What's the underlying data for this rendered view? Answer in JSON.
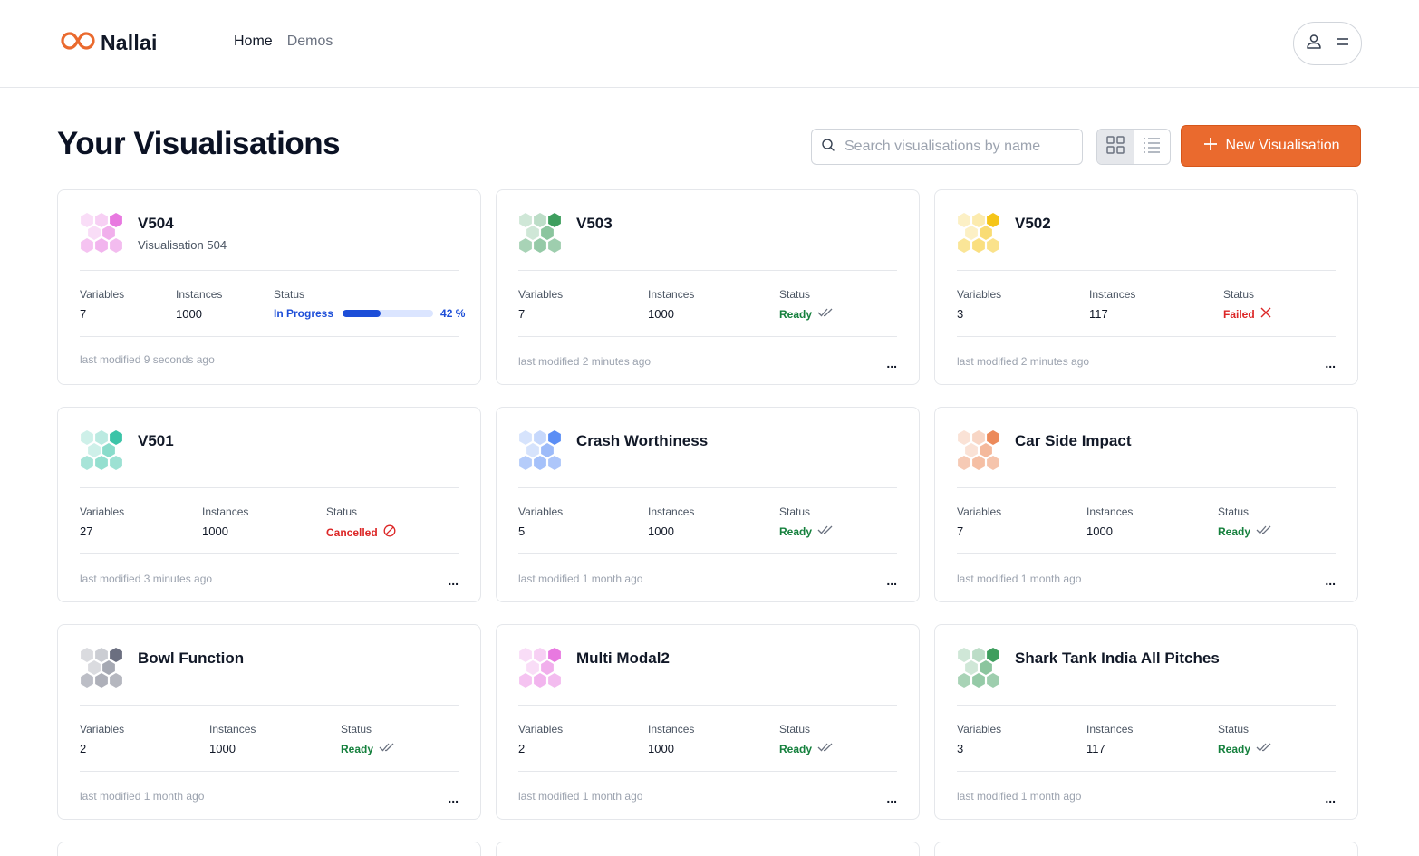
{
  "header": {
    "brand": "Nallai",
    "nav": {
      "home": "Home",
      "demos": "Demos"
    }
  },
  "page": {
    "title": "Your Visualisations",
    "search_placeholder": "Search visualisations by name",
    "new_button": "New Visualisation"
  },
  "labels": {
    "variables": "Variables",
    "instances": "Instances",
    "status": "Status",
    "more": "..."
  },
  "cards": [
    {
      "name": "V504",
      "description": "Visualisation 504",
      "variables": "7",
      "instances": "1000",
      "status": "In Progress",
      "status_type": "progress",
      "progress": 0.42,
      "progress_label": "42 %",
      "modified": "last modified 9 seconds ago",
      "color": "#e879e0"
    },
    {
      "name": "V503",
      "description": "",
      "variables": "7",
      "instances": "1000",
      "status": "Ready",
      "status_type": "ready",
      "modified": "last modified 2 minutes ago",
      "color": "#3e9e5e"
    },
    {
      "name": "V502",
      "description": "",
      "variables": "3",
      "instances": "117",
      "status": "Failed",
      "status_type": "failed",
      "modified": "last modified 2 minutes ago",
      "color": "#f5c518"
    },
    {
      "name": "V501",
      "description": "",
      "variables": "27",
      "instances": "1000",
      "status": "Cancelled",
      "status_type": "cancelled",
      "modified": "last modified 3 minutes ago",
      "color": "#3cc4a8"
    },
    {
      "name": "Crash Worthiness",
      "description": "",
      "variables": "5",
      "instances": "1000",
      "status": "Ready",
      "status_type": "ready",
      "modified": "last modified 1 month ago",
      "color": "#5b8ef5"
    },
    {
      "name": "Car Side Impact",
      "description": "",
      "variables": "7",
      "instances": "1000",
      "status": "Ready",
      "status_type": "ready",
      "modified": "last modified 1 month ago",
      "color": "#ec8a5a"
    },
    {
      "name": "Bowl Function",
      "description": "",
      "variables": "2",
      "instances": "1000",
      "status": "Ready",
      "status_type": "ready",
      "modified": "last modified 1 month ago",
      "color": "#6b6f80"
    },
    {
      "name": "Multi Modal2",
      "description": "",
      "variables": "2",
      "instances": "1000",
      "status": "Ready",
      "status_type": "ready",
      "modified": "last modified 1 month ago",
      "color": "#e879e0"
    },
    {
      "name": "Shark Tank India All Pitches",
      "description": "",
      "variables": "3",
      "instances": "117",
      "status": "Ready",
      "status_type": "ready",
      "modified": "last modified 1 month ago",
      "color": "#3e9e5e"
    }
  ],
  "colors": {
    "accent": "#ea6a2e",
    "ready": "#15803d",
    "failed": "#dc2626",
    "progress": "#1d4ed8"
  }
}
